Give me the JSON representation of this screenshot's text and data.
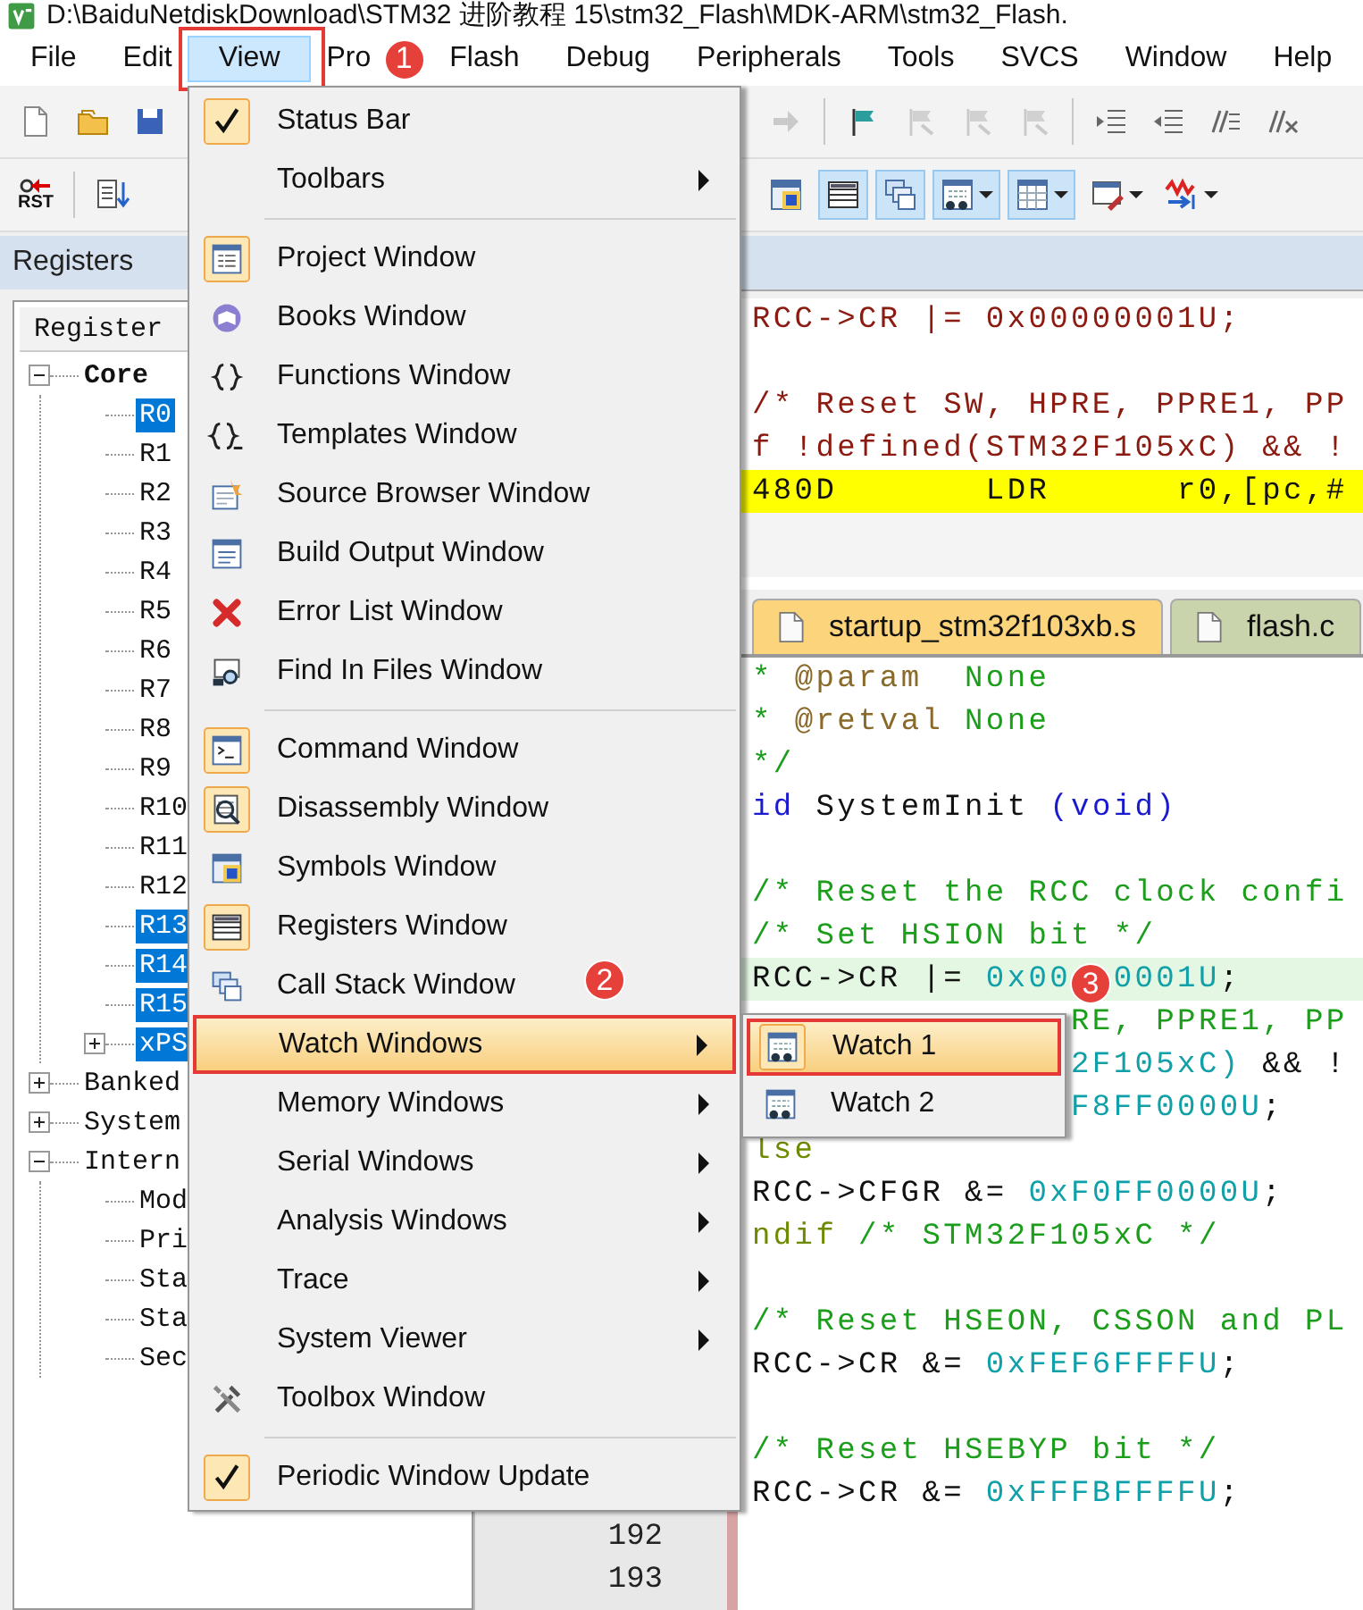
{
  "window": {
    "title": "D:\\BaiduNetdiskDownload\\STM32 进阶教程 15\\stm32_Flash\\MDK-ARM\\stm32_Flash."
  },
  "menubar": [
    {
      "label": "File",
      "selected": false,
      "outlined": false
    },
    {
      "label": "Edit",
      "selected": false,
      "outlined": false
    },
    {
      "label": "View",
      "selected": true,
      "outlined": true,
      "callout": "1"
    },
    {
      "label": "Pro",
      "selected": false,
      "outlined": false
    },
    {
      "label": "Flash",
      "selected": false,
      "outlined": false
    },
    {
      "label": "Debug",
      "selected": false,
      "outlined": false
    },
    {
      "label": "Peripherals",
      "selected": false,
      "outlined": false
    },
    {
      "label": "Tools",
      "selected": false,
      "outlined": false
    },
    {
      "label": "SVCS",
      "selected": false,
      "outlined": false
    },
    {
      "label": "Window",
      "selected": false,
      "outlined": false
    },
    {
      "label": "Help",
      "selected": false,
      "outlined": false
    }
  ],
  "toolbar_1": {
    "buttons": [
      {
        "disabled": false
      },
      {
        "disabled": false
      },
      {
        "disabled": false
      },
      {
        "disabled": true
      },
      {
        "disabled": false
      },
      {
        "disabled": true
      },
      {
        "disabled": true
      },
      {
        "disabled": true
      },
      {
        "disabled": false
      },
      {
        "disabled": false
      },
      {
        "disabled": false
      },
      {
        "disabled": false
      }
    ]
  },
  "toolbar_2": {
    "buttons": [
      {
        "label": "RST",
        "on": false,
        "dropdown": false
      },
      {
        "on": false,
        "dropdown": false
      },
      {
        "on": false,
        "dropdown": false
      },
      {
        "on": true,
        "dropdown": false
      },
      {
        "on": true,
        "dropdown": false
      },
      {
        "on": true,
        "dropdown": true
      },
      {
        "on": true,
        "dropdown": true
      },
      {
        "on": false,
        "dropdown": true
      },
      {
        "on": false,
        "dropdown": true
      }
    ]
  },
  "registers": {
    "title": "Registers",
    "column": "Register",
    "tree": [
      {
        "label": "Core",
        "emphasized": true,
        "expanded": true,
        "selected": false,
        "children": [
          {
            "label": "R0",
            "selected": true
          },
          {
            "label": "R1",
            "selected": false
          },
          {
            "label": "R2",
            "selected": false
          },
          {
            "label": "R3",
            "selected": false
          },
          {
            "label": "R4",
            "selected": false
          },
          {
            "label": "R5",
            "selected": false
          },
          {
            "label": "R6",
            "selected": false
          },
          {
            "label": "R7",
            "selected": false
          },
          {
            "label": "R8",
            "selected": false
          },
          {
            "label": "R9",
            "selected": false
          },
          {
            "label": "R10",
            "selected": false
          },
          {
            "label": "R11",
            "selected": false
          },
          {
            "label": "R12",
            "selected": false
          },
          {
            "label": "R13",
            "selected": true
          },
          {
            "label": "R14",
            "selected": true
          },
          {
            "label": "R15",
            "selected": true
          },
          {
            "label": "xPS",
            "selected": true,
            "expanded": false
          }
        ]
      },
      {
        "label": "Banked",
        "emphasized": false,
        "expanded": false,
        "selected": false
      },
      {
        "label": "System",
        "emphasized": false,
        "expanded": false,
        "selected": false
      },
      {
        "label": "Intern",
        "emphasized": false,
        "expanded": true,
        "selected": false,
        "children": [
          {
            "label": "Mod",
            "selected": false
          },
          {
            "label": "Pri",
            "selected": false
          },
          {
            "label": "Sta",
            "selected": false
          },
          {
            "label": "Sta",
            "selected": false
          },
          {
            "label": "Sec",
            "selected": false
          }
        ]
      }
    ]
  },
  "disassembly": {
    "rows": [
      {
        "text": "RCC->CR |= 0x00000001U;",
        "kind": "source",
        "current": false
      },
      {
        "current": false
      },
      {
        "text": "/* Reset SW, HPRE, PPRE1, PP",
        "kind": "source",
        "current": false
      },
      {
        "text": "f !defined(STM32F105xC) && !",
        "kind": "source",
        "current": false
      },
      {
        "text": "480D       LDR      r0,[pc,#",
        "kind": "instruction",
        "current": true
      }
    ]
  },
  "tabs": [
    {
      "label": "startup_stm32f103xb.s",
      "color": "#fbd47c"
    },
    {
      "label": "flash.c",
      "color": "#c9d4ad"
    }
  ],
  "editor": {
    "rows": [
      {
        "current": false,
        "segments": [
          {
            "text": "* ",
            "kind": "comment"
          },
          {
            "text": "@param  ",
            "kind": "doctag"
          },
          {
            "text": "None",
            "kind": "comment"
          }
        ]
      },
      {
        "current": false,
        "segments": [
          {
            "text": "* ",
            "kind": "comment"
          },
          {
            "text": "@retval ",
            "kind": "doctag"
          },
          {
            "text": "None",
            "kind": "comment"
          }
        ]
      },
      {
        "current": false,
        "segments": [
          {
            "text": "*/",
            "kind": "comment"
          }
        ]
      },
      {
        "current": false,
        "segments": [
          {
            "text": "id",
            "kind": "keyword"
          },
          {
            "text": " SystemInit ",
            "kind": "code"
          },
          {
            "text": "(void)",
            "kind": "keyword"
          }
        ]
      },
      {
        "current": false
      },
      {
        "current": false,
        "segments": [
          {
            "text": "/* Reset the RCC clock confi",
            "kind": "comment"
          }
        ]
      },
      {
        "current": false,
        "segments": [
          {
            "text": "/* Set HSION bit */",
            "kind": "comment"
          }
        ]
      },
      {
        "current": true,
        "segments": [
          {
            "text": "RCC->CR |= ",
            "kind": "code"
          },
          {
            "text": "0x00",
            "kind": "number"
          },
          {
            "text": "  0001U",
            "kind": "number"
          },
          {
            "text": ";",
            "kind": "code"
          }
        ]
      },
      {
        "current": false,
        "segments": [
          {
            "text": "               RE, PPRE1, PP",
            "kind": "comment"
          }
        ]
      },
      {
        "current": false,
        "segments": [
          {
            "text": "               2F105xC)",
            "kind": "number"
          },
          {
            "text": " && !",
            "kind": "code"
          }
        ]
      },
      {
        "current": false,
        "segments": [
          {
            "text": "               F8FF0000U",
            "kind": "number"
          },
          {
            "text": ";",
            "kind": "code"
          }
        ]
      },
      {
        "current": false,
        "segments": [
          {
            "text": "lse",
            "kind": "preproc"
          }
        ]
      },
      {
        "current": false,
        "segments": [
          {
            "text": "RCC->CFGR &= ",
            "kind": "code"
          },
          {
            "text": "0xF0FF0000U",
            "kind": "number"
          },
          {
            "text": ";",
            "kind": "code"
          }
        ]
      },
      {
        "current": false,
        "segments": [
          {
            "text": "ndif",
            "kind": "preproc"
          },
          {
            "text": " /* STM32F105xC */",
            "kind": "comment"
          }
        ]
      },
      {
        "current": false
      },
      {
        "current": false,
        "segments": [
          {
            "text": "/* Reset HSEON, CSSON and PL",
            "kind": "comment"
          }
        ]
      },
      {
        "current": false,
        "segments": [
          {
            "text": "RCC->CR &= ",
            "kind": "code"
          },
          {
            "text": "0xFEF6FFFFU",
            "kind": "number"
          },
          {
            "text": ";",
            "kind": "code"
          }
        ]
      },
      {
        "current": false
      },
      {
        "current": false,
        "segments": [
          {
            "text": "/* Reset HSEBYP bit */",
            "kind": "comment"
          }
        ]
      },
      {
        "current": false,
        "segments": [
          {
            "text": "RCC->CR &= ",
            "kind": "code"
          },
          {
            "text": "0xFFFBFFFFU",
            "kind": "number"
          },
          {
            "text": ";",
            "kind": "code"
          }
        ]
      },
      {
        "current": false,
        "number": "192"
      },
      {
        "current": false,
        "number": "193"
      }
    ]
  },
  "view_menu": {
    "items": [
      {
        "label": "Status Bar",
        "kind": "check",
        "checked": true,
        "submenu": false,
        "selected": false,
        "outlined": false
      },
      {
        "label": "Toolbars",
        "kind": "plain",
        "submenu": true,
        "selected": false,
        "outlined": false
      },
      {
        "kind": "separator"
      },
      {
        "label": "Project Window",
        "kind": "icon",
        "checked": true,
        "submenu": false,
        "selected": false,
        "outlined": false
      },
      {
        "label": "Books Window",
        "kind": "icon",
        "checked": false,
        "submenu": false,
        "selected": false,
        "outlined": false
      },
      {
        "label": "Functions Window",
        "kind": "icon",
        "checked": false,
        "submenu": false,
        "selected": false,
        "outlined": false
      },
      {
        "label": "Templates Window",
        "kind": "icon",
        "checked": false,
        "submenu": false,
        "selected": false,
        "outlined": false
      },
      {
        "label": "Source Browser Window",
        "kind": "icon",
        "checked": false,
        "submenu": false,
        "selected": false,
        "outlined": false
      },
      {
        "label": "Build Output Window",
        "kind": "icon",
        "checked": false,
        "submenu": false,
        "selected": false,
        "outlined": false
      },
      {
        "label": "Error List Window",
        "kind": "icon",
        "checked": false,
        "submenu": false,
        "selected": false,
        "outlined": false
      },
      {
        "label": "Find In Files Window",
        "kind": "icon",
        "checked": false,
        "submenu": false,
        "selected": false,
        "outlined": false
      },
      {
        "kind": "separator"
      },
      {
        "label": "Command Window",
        "kind": "icon",
        "checked": true,
        "submenu": false,
        "selected": false,
        "outlined": false
      },
      {
        "label": "Disassembly Window",
        "kind": "icon",
        "checked": true,
        "submenu": false,
        "selected": false,
        "outlined": false
      },
      {
        "label": "Symbols Window",
        "kind": "icon",
        "checked": false,
        "submenu": false,
        "selected": false,
        "outlined": false
      },
      {
        "label": "Registers Window",
        "kind": "icon",
        "checked": true,
        "submenu": false,
        "selected": false,
        "outlined": false
      },
      {
        "label": "Call Stack Window",
        "kind": "icon",
        "checked": false,
        "submenu": false,
        "selected": false,
        "outlined": false
      },
      {
        "label": "Watch Windows",
        "kind": "plain",
        "submenu": true,
        "selected": true,
        "outlined": true,
        "callout": "2"
      },
      {
        "label": "Memory Windows",
        "kind": "plain",
        "submenu": true,
        "selected": false,
        "outlined": false
      },
      {
        "label": "Serial Windows",
        "kind": "plain",
        "submenu": true,
        "selected": false,
        "outlined": false
      },
      {
        "label": "Analysis Windows",
        "kind": "plain",
        "submenu": true,
        "selected": false,
        "outlined": false
      },
      {
        "label": "Trace",
        "kind": "plain",
        "submenu": true,
        "selected": false,
        "outlined": false
      },
      {
        "label": "System Viewer",
        "kind": "plain",
        "submenu": true,
        "selected": false,
        "outlined": false
      },
      {
        "label": "Toolbox Window",
        "kind": "icon",
        "checked": false,
        "submenu": false,
        "selected": false,
        "outlined": false
      },
      {
        "kind": "separator"
      },
      {
        "label": "Periodic Window Update",
        "kind": "check",
        "checked": true,
        "submenu": false,
        "selected": false,
        "outlined": false
      }
    ]
  },
  "watch_submenu": {
    "items": [
      {
        "label": "Watch 1",
        "kind": "icon",
        "checked": true,
        "submenu": false,
        "selected": true,
        "outlined": true,
        "callout": "3"
      },
      {
        "label": "Watch 2",
        "kind": "icon",
        "checked": false,
        "submenu": false,
        "selected": false,
        "outlined": false
      }
    ]
  }
}
